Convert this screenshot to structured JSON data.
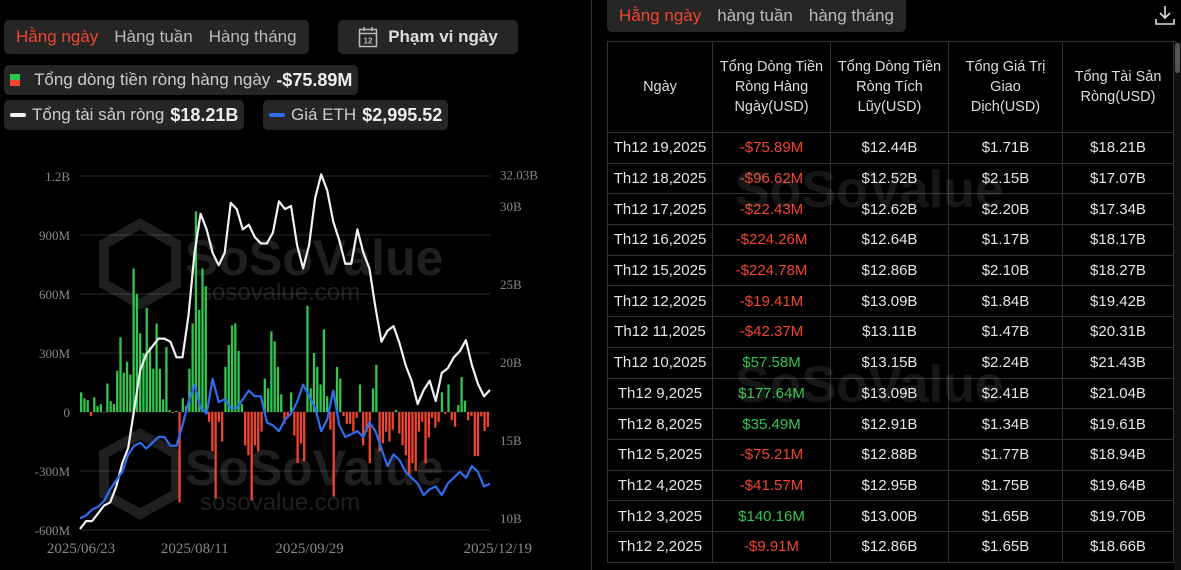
{
  "left": {
    "period_tabs": [
      "Hằng ngày",
      "Hàng tuần",
      "Hàng tháng"
    ],
    "active_tab": 0,
    "date_range_label": "Phạm vi ngày",
    "calendar_icon_text": "12",
    "legend": {
      "daily_flow_label": "Tổng dòng tiền ròng hàng ngày",
      "daily_flow_value": "-$75.89M",
      "net_assets_label": "Tổng tài sản ròng",
      "net_assets_value": "$18.21B",
      "eth_label": "Giá ETH",
      "eth_value": "$2,995.52"
    }
  },
  "colors": {
    "accent": "#f0452f",
    "positive": "#32c650",
    "negative": "#f0452f",
    "net_assets": "#f2f2f2",
    "eth": "#2f6df0"
  },
  "watermark": {
    "brand": "SoSoValue",
    "site": "sosovalue.com"
  },
  "chart_data": {
    "type": "bar+line",
    "left_axis": {
      "ticks": [
        "1.2B",
        "900M",
        "600M",
        "300M",
        "0",
        "-300M",
        "-600M"
      ],
      "range": [
        -600,
        1200
      ],
      "unit": "M USD"
    },
    "right_axis": {
      "ticks": [
        "32.03B",
        "30B",
        "25B",
        "20B",
        "15B",
        "10B"
      ],
      "tick_values": [
        32.03,
        30,
        25,
        20,
        15,
        10
      ],
      "unit": "B USD"
    },
    "x_ticks": [
      "2025/06/23",
      "2025/08/11",
      "2025/09/29",
      "2025/12/19"
    ],
    "x_tick_positions": [
      0,
      35,
      70,
      126
    ],
    "eth_range": [
      2200,
      8290
    ],
    "daily_net_flow_M": [
      100,
      70,
      60,
      -20,
      75,
      30,
      40,
      0,
      145,
      55,
      40,
      210,
      380,
      200,
      255,
      190,
      730,
      600,
      400,
      300,
      530,
      330,
      220,
      450,
      220,
      65,
      330,
      10,
      -5,
      5,
      -460,
      70,
      30,
      220,
      450,
      1020,
      520,
      730,
      640,
      -50,
      -200,
      -440,
      -50,
      -150,
      230,
      340,
      440,
      450,
      310,
      40,
      -170,
      -220,
      -450,
      -170,
      -200,
      -100,
      170,
      120,
      410,
      360,
      230,
      90,
      -60,
      -30,
      100,
      -120,
      -260,
      -160,
      -250,
      540,
      120,
      300,
      230,
      140,
      420,
      80,
      -90,
      -430,
      230,
      170,
      -20,
      -60,
      -60,
      -100,
      -30,
      140,
      -170,
      -100,
      -260,
      120,
      240,
      -200,
      -160,
      -100,
      -150,
      -90,
      10,
      -110,
      -170,
      -220,
      -320,
      -260,
      -300,
      -100,
      -50,
      -260,
      -130,
      -30,
      -80,
      -50,
      100,
      -9.91,
      140.16,
      -41.57,
      -75.21,
      35.49,
      177.64,
      57.58,
      -42.37,
      -19.41,
      -224.78,
      -224.26,
      -22.43,
      -96.62,
      -75.89
    ],
    "net_assets_B": [
      9.3,
      9.8,
      9.8,
      10.3,
      10.8,
      11,
      12,
      13.5,
      14.5,
      17,
      19.5,
      20.5,
      21,
      21.5,
      21.5,
      21.3,
      20.3,
      20.3,
      23,
      27,
      29.5,
      28.5,
      27,
      26.2,
      27,
      30.2,
      29.8,
      28.5,
      28.8,
      28,
      27.6,
      27.6,
      28.3,
      30.3,
      29.8,
      30,
      27.5,
      26,
      27.5,
      30.5,
      32.03,
      31,
      29,
      27.8,
      26.3,
      26.3,
      28.5,
      27,
      26,
      23.5,
      21.3,
      22,
      22.3,
      21.2,
      19.8,
      18.8,
      17.3,
      18.2,
      18.8,
      17.5,
      19.3,
      19.6,
      20.3,
      20.7,
      21.4,
      19.8,
      18.6,
      17.8,
      18.21
    ],
    "eth_price": [
      2400,
      2450,
      2550,
      2600,
      2700,
      2900,
      3050,
      3200,
      3500,
      3650,
      3700,
      3600,
      3700,
      3800,
      3800,
      3650,
      3650,
      4000,
      4400,
      4700,
      4300,
      4200,
      4800,
      4400,
      4450,
      4300,
      4300,
      4450,
      4600,
      4500,
      4500,
      4050,
      4000,
      3900,
      4100,
      4200,
      4400,
      4700,
      4500,
      4300,
      3900,
      4100,
      4600,
      4000,
      3800,
      3850,
      3900,
      3800,
      4050,
      3900,
      3600,
      3300,
      3500,
      3400,
      3200,
      3100,
      3000,
      2800,
      2900,
      2950,
      2800,
      3000,
      3100,
      3200,
      3100,
      3300,
      3200,
      2950,
      2995.52
    ]
  },
  "right": {
    "period_tabs": [
      "Hằng ngày",
      "hàng tuần",
      "hàng tháng"
    ],
    "active_tab": 0,
    "columns": [
      "Ngày",
      "Tổng Dòng Tiền Ròng Hàng Ngày(USD)",
      "Tổng Dòng Tiền Ròng Tích Lũy(USD)",
      "Tổng Giá Trị Giao Dịch(USD)",
      "Tổng Tài Sản Ròng(USD)"
    ],
    "rows": [
      [
        "Th12 19,2025",
        "-$75.89M",
        "$12.44B",
        "$1.71B",
        "$18.21B"
      ],
      [
        "Th12 18,2025",
        "-$96.62M",
        "$12.52B",
        "$2.15B",
        "$17.07B"
      ],
      [
        "Th12 17,2025",
        "-$22.43M",
        "$12.62B",
        "$2.20B",
        "$17.34B"
      ],
      [
        "Th12 16,2025",
        "-$224.26M",
        "$12.64B",
        "$1.17B",
        "$18.17B"
      ],
      [
        "Th12 15,2025",
        "-$224.78M",
        "$12.86B",
        "$2.10B",
        "$18.27B"
      ],
      [
        "Th12 12,2025",
        "-$19.41M",
        "$13.09B",
        "$1.84B",
        "$19.42B"
      ],
      [
        "Th12 11,2025",
        "-$42.37M",
        "$13.11B",
        "$1.47B",
        "$20.31B"
      ],
      [
        "Th12 10,2025",
        "$57.58M",
        "$13.15B",
        "$2.24B",
        "$21.43B"
      ],
      [
        "Th12 9,2025",
        "$177.64M",
        "$13.09B",
        "$2.41B",
        "$21.04B"
      ],
      [
        "Th12 8,2025",
        "$35.49M",
        "$12.91B",
        "$1.34B",
        "$19.61B"
      ],
      [
        "Th12 5,2025",
        "-$75.21M",
        "$12.88B",
        "$1.77B",
        "$18.94B"
      ],
      [
        "Th12 4,2025",
        "-$41.57M",
        "$12.95B",
        "$1.75B",
        "$19.64B"
      ],
      [
        "Th12 3,2025",
        "$140.16M",
        "$13.00B",
        "$1.65B",
        "$19.70B"
      ],
      [
        "Th12 2,2025",
        "-$9.91M",
        "$12.86B",
        "$1.65B",
        "$18.66B"
      ]
    ]
  }
}
